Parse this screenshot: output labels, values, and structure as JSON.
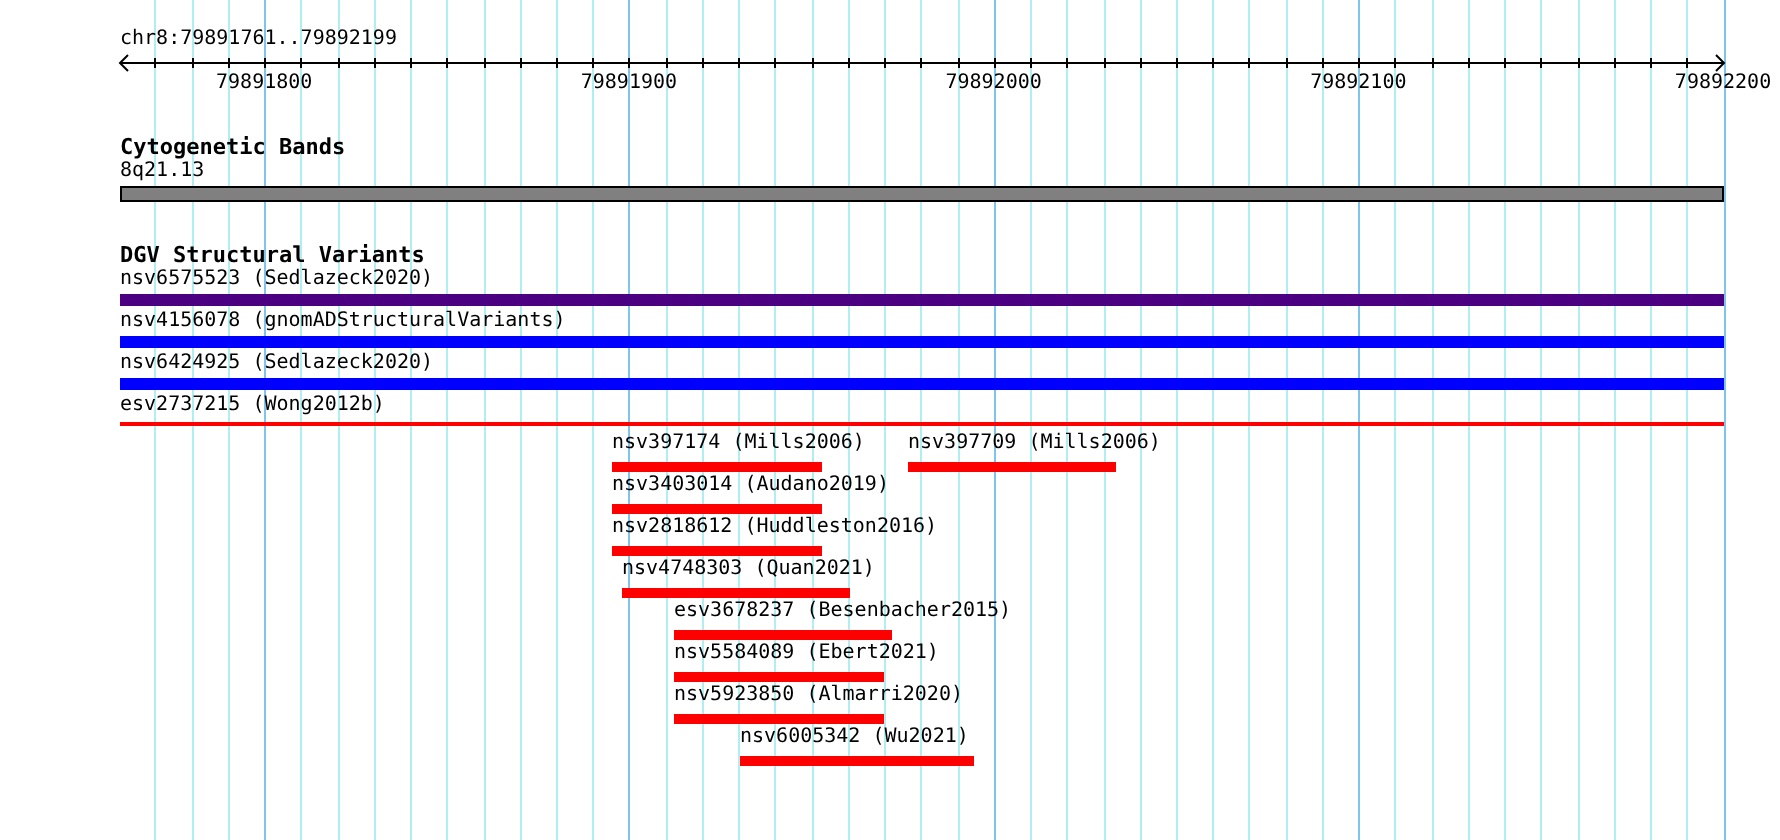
{
  "ruler": {
    "location": "chr8:79891761..79892199",
    "ticks": [
      "79891800",
      "79891900",
      "79892000",
      "79892100",
      "79892200"
    ]
  },
  "tracks": [
    {
      "title": "Cytogenetic Bands",
      "features": [
        {
          "label": "8q21.13",
          "kind": "band",
          "color": "#808080"
        }
      ]
    },
    {
      "title": "DGV Structural Variants",
      "features": [
        {
          "label": "nsv6575523 (Sedlazeck2020)",
          "kind": "full",
          "color": "#4b0082"
        },
        {
          "label": "nsv4156078 (gnomADStructuralVariants)",
          "kind": "full",
          "color": "#0000ff"
        },
        {
          "label": "nsv6424925 (Sedlazeck2020)",
          "kind": "full",
          "color": "#0000ff"
        },
        {
          "label": "esv2737215 (Wong2012b)",
          "kind": "line",
          "color": "#ff0000"
        },
        {
          "label": "nsv397174 (Mills2006)",
          "kind": "bar",
          "color": "#ff0000"
        },
        {
          "label": "nsv397709 (Mills2006)",
          "kind": "bar",
          "color": "#ff0000"
        },
        {
          "label": "nsv3403014 (Audano2019)",
          "kind": "bar",
          "color": "#ff0000"
        },
        {
          "label": "nsv2818612 (Huddleston2016)",
          "kind": "bar",
          "color": "#ff0000"
        },
        {
          "label": "nsv4748303 (Quan2021)",
          "kind": "bar",
          "color": "#ff0000"
        },
        {
          "label": "esv3678237 (Besenbacher2015)",
          "kind": "bar",
          "color": "#ff0000"
        },
        {
          "label": "nsv5584089 (Ebert2021)",
          "kind": "bar",
          "color": "#ff0000"
        },
        {
          "label": "nsv5923850 (Almarri2020)",
          "kind": "bar",
          "color": "#ff0000"
        },
        {
          "label": "nsv6005342 (Wu2021)",
          "kind": "bar",
          "color": "#ff0000"
        }
      ]
    }
  ]
}
